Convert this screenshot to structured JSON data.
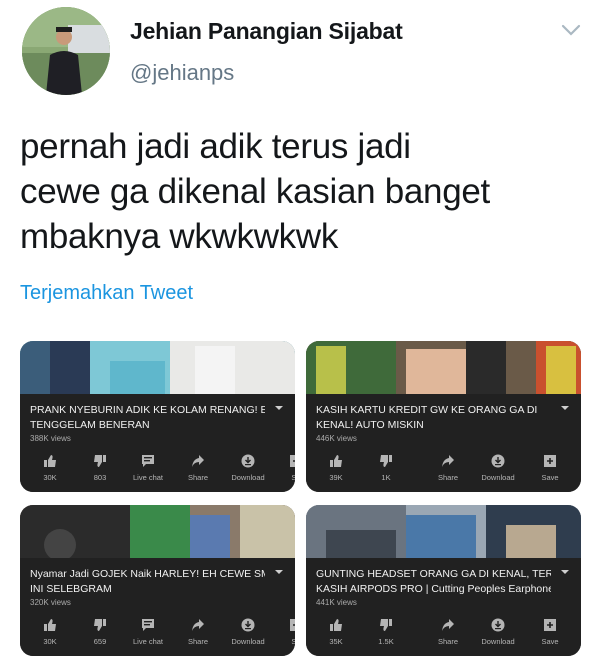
{
  "tweet": {
    "author_name": "Jehian Panangian Sijabat",
    "author_handle": "@jehianps",
    "text_lines": [
      "pernah jadi adik terus jadi",
      "cewe ga dikenal kasian banget",
      "mbaknya wkwkwkwk"
    ],
    "translate_label": "Terjemahkan Tweet"
  },
  "videos": [
    {
      "title_lines": [
        "PRANK NYEBURIN ADIK KE KOLAM RENANG! EH",
        "TENGGELAM BENERAN"
      ],
      "views": "388K views",
      "actions": [
        "30K",
        "803",
        "Live chat",
        "Share",
        "Download",
        "Sa"
      ]
    },
    {
      "title_lines": [
        "KASIH KARTU KREDIT GW KE ORANG GA DI",
        "KENAL! AUTO MISKIN"
      ],
      "views": "446K views",
      "actions": [
        "39K",
        "1K",
        "Share",
        "Download",
        "Save"
      ]
    },
    {
      "title_lines": [
        "Nyamar Jadi GOJEK Naik HARLEY! EH CEWE SMA",
        "INI SELEBGRAM"
      ],
      "views": "320K views",
      "actions": [
        "30K",
        "659",
        "Live chat",
        "Share",
        "Download",
        "Sa"
      ]
    },
    {
      "title_lines": [
        "GUNTING HEADSET ORANG GA DI KENAL, TERUS",
        "KASIH AIRPODS PRO | Cutting Peoples Earphones..."
      ],
      "views": "441K views",
      "actions": [
        "35K",
        "1.5K",
        "Share",
        "Download",
        "Save"
      ]
    }
  ],
  "colors": {
    "link": "#1b95e0",
    "card_bg": "#212121",
    "handle": "#657786"
  }
}
